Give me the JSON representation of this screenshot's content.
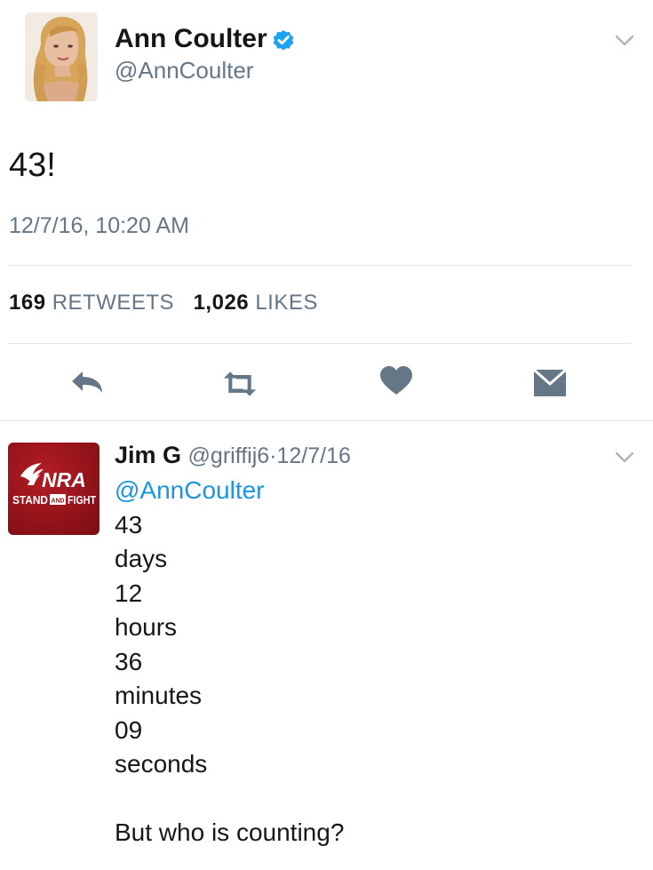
{
  "tweet": {
    "author_name": "Ann Coulter",
    "author_handle": "@AnnCoulter",
    "text": "43!",
    "timestamp": "12/7/16, 10:20 AM",
    "retweets_count": "169",
    "retweets_label": "RETWEETS",
    "likes_count": "1,026",
    "likes_label": "LIKES"
  },
  "actions": [
    "reply-icon",
    "retweet-icon",
    "heart-icon",
    "dm-icon"
  ],
  "reply": {
    "author_name": "Jim G",
    "author_handle": "@griffij6",
    "separator": "·",
    "date": "12/7/16",
    "mention": "@AnnCoulter",
    "lines": [
      "43",
      "days",
      "12",
      "hours",
      "36",
      "minutes",
      "09",
      "seconds",
      "",
      "But who is counting?"
    ],
    "avatar_text": {
      "brand": "NRA",
      "tagline_left": "STAND",
      "tagline_mid": "AND",
      "tagline_right": "FIGHT"
    }
  },
  "colors": {
    "text": "#14171a",
    "secondary": "#657786",
    "link": "#1b95e0",
    "verified": "#1da1f2",
    "divider": "#e1e8ed",
    "nra_red": "#a0161d"
  }
}
